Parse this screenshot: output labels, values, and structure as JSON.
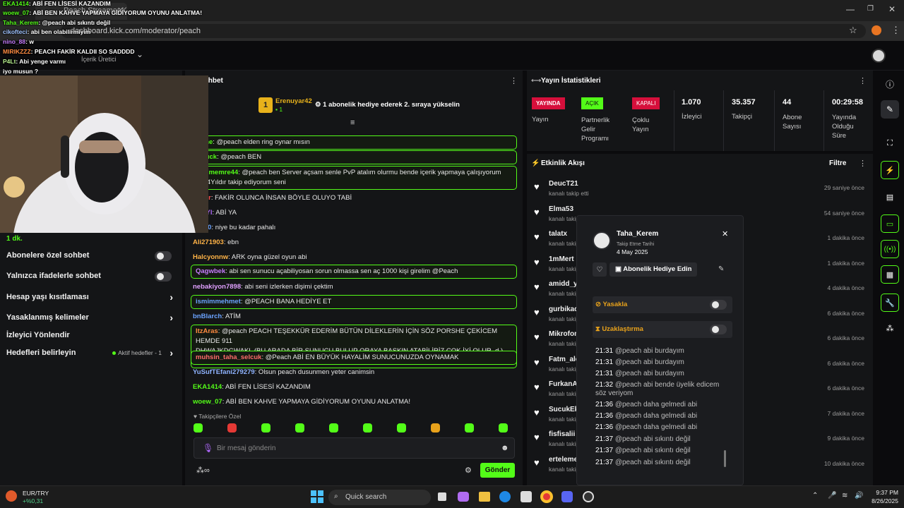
{
  "browser": {
    "tab_title": "Peach Streamer Kick Dashboard",
    "url": "dashboard.kick.com/moderator/peach"
  },
  "header": {
    "creator_label": "İçerik Üretici"
  },
  "left_panel": {
    "followers_delay_value": "1 dk.",
    "sub_only_label": "Abonelere özel sohbet",
    "emote_only_label": "Yalnızca ifadelerle sohbet",
    "account_age_label": "Hesap yaşı kısıtlaması",
    "banned_words_label": "Yasaklanmış kelimeler",
    "viewer_guide_label": "İzleyici Yönlendir",
    "goals_label": "Hedefleri belirleyin",
    "active_goals_label": "Aktif hedefler - 1"
  },
  "chat": {
    "title": "Sohbet",
    "pinned_user": "Erenuyar42",
    "pinned_rank": "1",
    "pinned_count": "1",
    "pinned_message": "1 abonelik hediye ederek 2. sıraya yükselin",
    "messages": [
      {
        "user": "...ene",
        "text": ": @peach elden ring oynar mısın",
        "user_color": "#53fc18",
        "hl": true
      },
      {
        "user": "...duck",
        "text": ": @peach BEN",
        "user_color": "#53fc18",
        "hl": true
      },
      {
        "user": "...elimemre44",
        "text": ": @peach ben Server açsam senle PvP atalım olurmu bende içerik yapmaya çalışıyorum",
        "text2": "...n 4Yıldır takip ediyorum seni",
        "user_color": "#53fc18",
        "hl": true
      },
      {
        "user": "...Flor",
        "text": ": FAKİR OLUNCA İNSAN BÖYLE OLUYO TABİ",
        "user_color": "#ff4d4d",
        "hl": false
      },
      {
        "user": "...54Yl",
        "text": ": ABİ YA",
        "user_color": "#b169ff",
        "hl": false
      },
      {
        "user": "...ki00",
        "text": ": niye bu kadar pahalı",
        "user_color": "#6ba3ff",
        "hl": false
      },
      {
        "user": "Ali271903",
        "text": ": ebn",
        "user_color": "#ffb347",
        "hl": false
      },
      {
        "user": "Halcyonnw",
        "text": ": ARK oyna güzel oyun abi",
        "user_color": "#ffb347",
        "hl": false
      },
      {
        "user": "Qagwbek",
        "text": ": abi sen sunucu açabiliyosan sorun olmassa sen aç 1000 kişi girelim",
        "text3": " @Peach",
        "user_color": "#c77dff",
        "hl": true
      },
      {
        "user": "nebakiyon7898",
        "text": ": abi seni izlerken dişimi çektim",
        "user_color": "#e0a0ff",
        "hl": false
      },
      {
        "user": "ismimmehmet",
        "text": ": @PEACH BANA HEDİYE ET",
        "user_color": "#6ba3ff",
        "hl": true
      },
      {
        "user": "bnBlarch",
        "text": ": ATİM",
        "user_color": "#6ba3ff",
        "hl": false
      },
      {
        "user": "ItzAras",
        "text": ": @peach PEACH TEŞEKKÜR EDERİM BÜTÜN DİLEKLERİN İÇİN SÖZ PORSHE ÇEKİCEM HEMDE 911",
        "text2": "DHWAJKDGWAKL (BU ARADA BİR SUNUCU BULUP ORAYA BASKIN ATABİLİRİZ ÇOK İYİ OLUR .d ) ÖHM",
        "user_color": "#ff8c42",
        "hl": true
      },
      {
        "user": "muhsin_taha_selcuk",
        "text": ": @Peach ABİ EN BÜYÜK HAYALİM SUNUCUNUZDA OYNAMAK",
        "user_color": "#ff6b6b",
        "hl": true
      },
      {
        "user": "YuSufTEfani279279",
        "text": ": Olsun peach dusunmen yeter canimsin",
        "user_color": "#8fb3ff",
        "hl": false
      },
      {
        "user": "EKA1414",
        "text": ": ABİ FEN LİSESİ KAZANDIM",
        "user_color": "#53fc18",
        "hl": false
      },
      {
        "user": "woew_07",
        "text": ": ABİ BEN KAHVE YAPMAYA GİDİYORUM OYUNU ANLATMA!",
        "user_color": "#53fc18",
        "hl": false
      }
    ],
    "followers_only_label": "Takipçilere Özel",
    "input_placeholder": "Bir mesaj gönderin",
    "send_label": "Gönder"
  },
  "stats": {
    "title": "Yayın İstatistikleri",
    "stream_badge": "YAYINDA",
    "stream_label": "Yayın",
    "partner_badge": "AÇIK",
    "partner_label": "Partnerlik Gelir Programı",
    "multi_badge": "KAPALI",
    "multi_label": "Çoklu Yayın",
    "viewers_value": "1.070",
    "viewers_label": "İzleyici",
    "followers_value": "35.357",
    "followers_label": "Takipçi",
    "subs_value": "44",
    "subs_label": "Abone Sayısı",
    "uptime_value": "00:29:58",
    "uptime_label": "Yayında Olduğu Süre"
  },
  "activity": {
    "title": "Etkinlik Akışı",
    "filter_label": "Filtre",
    "items": [
      {
        "name": "DeucT21",
        "sub": "kanalı takip etti",
        "time": "29 saniye önce"
      },
      {
        "name": "Elma53",
        "sub": "kanalı takip etti",
        "time": "54 saniye önce"
      },
      {
        "name": "talatx",
        "sub": "kanalı takip etti",
        "time": "1 dakika önce"
      },
      {
        "name": "1mMert",
        "sub": "kanalı takip etti",
        "time": "1 dakika önce"
      },
      {
        "name": "amidd_y",
        "sub": "kanalı takip etti",
        "time": "4 dakika önce"
      },
      {
        "name": "gurbikad",
        "sub": "kanalı takip etti",
        "time": "6 dakika önce"
      },
      {
        "name": "Mikrofon",
        "sub": "kanalı takip etti",
        "time": "6 dakika önce"
      },
      {
        "name": "Fatm_alc",
        "sub": "kanalı takip etti",
        "time": "6 dakika önce"
      },
      {
        "name": "FurkanA",
        "sub": "kanalı takip etti",
        "time": "6 dakika önce"
      },
      {
        "name": "SucukEk",
        "sub": "kanalı takip etti",
        "time": "7 dakika önce"
      },
      {
        "name": "fisfisalii",
        "sub": "kanalı takip etti",
        "time": "9 dakika önce"
      },
      {
        "name": "erteleme",
        "sub": "kanalı takip etti",
        "time": "10 dakika önce"
      }
    ]
  },
  "popup": {
    "username": "Taha_Kerem",
    "follow_date_label": "Takip Etme Tarihi",
    "follow_date": "4 May 2025",
    "gift_label": "Abonelik Hediye Edin",
    "ban_label": "Yasakla",
    "timeout_label": "Uzaklaştırma",
    "log": [
      {
        "time": "21:31",
        "msg": "@peach abi burdayım"
      },
      {
        "time": "21:31",
        "msg": "@peach abi burdayım"
      },
      {
        "time": "21:31",
        "msg": "@peach abi burdayım"
      },
      {
        "time": "21:32",
        "msg": "@peach abi bende üyelik edicem söz veriyom"
      },
      {
        "time": "21:36",
        "msg": "@peach daha gelmedi abi"
      },
      {
        "time": "21:36",
        "msg": "@peach daha gelmedi abi"
      },
      {
        "time": "21:36",
        "msg": "@peach daha gelmedi abi"
      },
      {
        "time": "21:37",
        "msg": "@peach abi sıkıntı değil"
      },
      {
        "time": "21:37",
        "msg": "@peach abi sıkıntı değil"
      },
      {
        "time": "21:37",
        "msg": "@peach abi sıkıntı değil"
      }
    ]
  },
  "overlay": {
    "lines": [
      {
        "user": "EKA1414",
        "text": ": ABİ FEN LİSESİ KAZANDIM"
      },
      {
        "user": "woew_07",
        "text": ": ABİ BEN KAHVE YAPMAYA GİDİYORUM OYUNU ANLATMA!"
      },
      {
        "user": "Taha_Kerem",
        "text": ": @peach abi sıkıntı değil"
      },
      {
        "user": "cikofteci",
        "text": ": abi ben olabilirmiyim"
      },
      {
        "user": "nino_88",
        "text": ": w"
      },
      {
        "user": "MIRIKZZZ",
        "text": ": PEACH FAKİR KALDII SO SADDDD"
      },
      {
        "user": "P4Lt",
        "text": ": Abi yenge varmı"
      },
      {
        "user": "",
        "text": "iyo musun ?"
      }
    ]
  },
  "taskbar": {
    "currency_pair": "EUR/TRY",
    "currency_change": "+%0,31",
    "search_label": "Quick search",
    "time": "9:37 PM",
    "date": "8/26/2025"
  }
}
